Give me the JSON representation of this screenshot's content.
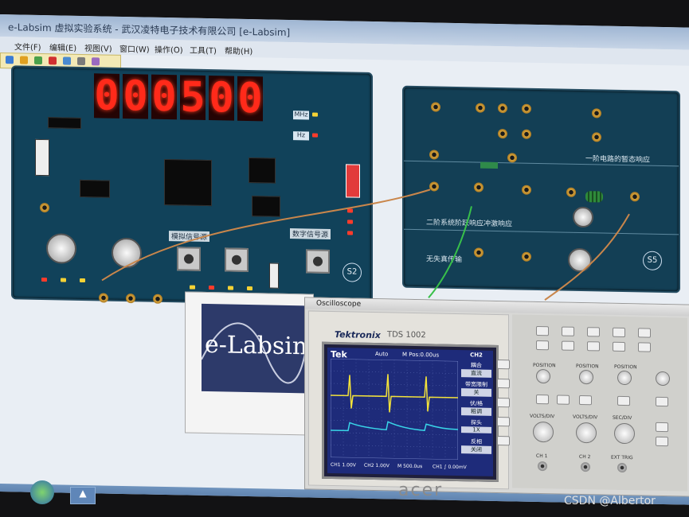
{
  "window": {
    "title": "e-Labsim 虚拟实验系统 - 武汉凌特电子技术有限公司 [e-Labsim]"
  },
  "menu": [
    "文件(F)",
    "编辑(E)",
    "视图(V)",
    "窗口(W)",
    "操作(O)",
    "工具(T)",
    "帮助(H)"
  ],
  "left_board": {
    "display_digits": [
      "0",
      "0",
      "0",
      "5",
      "0",
      "0"
    ],
    "unit_mhz": "MHz",
    "unit_hz": "Hz",
    "module_label": "模拟信号源",
    "module_label2": "数字信号源",
    "s_badge": "S2"
  },
  "right_board": {
    "section1": "一阶电路的暂态响应",
    "section2": "二阶系统阶跃响应冲激响应",
    "section3": "无失真传输",
    "s_badge": "S5"
  },
  "splash": {
    "logo_text": "e-Labsim"
  },
  "oscilloscope": {
    "window_title": "Oscilloscope",
    "brand": "Tektronix",
    "model": "TDS 1002",
    "screen_tek": "Tek",
    "screen_status": "Auto",
    "screen_trigger": "M Pos:0.00us",
    "menu_header": "CH2",
    "softkeys": [
      "耦合",
      "直流",
      "带宽限制",
      "关",
      "伏/格",
      "粗调",
      "探头",
      "1X",
      "反相",
      "关闭"
    ],
    "footer_ch1": "CH1 1.00V",
    "footer_ch2": "CH2 1.00V",
    "footer_time": "M 500.0us",
    "footer_trig": "CH1 ∫ 0.00mV",
    "panel_labels": [
      "POSITION",
      "POSITION",
      "POSITION",
      "VOLTS/DIV",
      "VOLTS/DIV",
      "SEC/DIV",
      "CH 1",
      "CH 2",
      "EXT TRIG"
    ]
  },
  "monitor_brand": "acer",
  "watermark": "CSDN @Albertor",
  "colors": {
    "board": "#11425a",
    "segment_red": "#ff2a1a",
    "trace_ch1": "#f3e23a",
    "trace_ch2": "#39d5e8",
    "scope_screen": "#1e2b7a"
  }
}
